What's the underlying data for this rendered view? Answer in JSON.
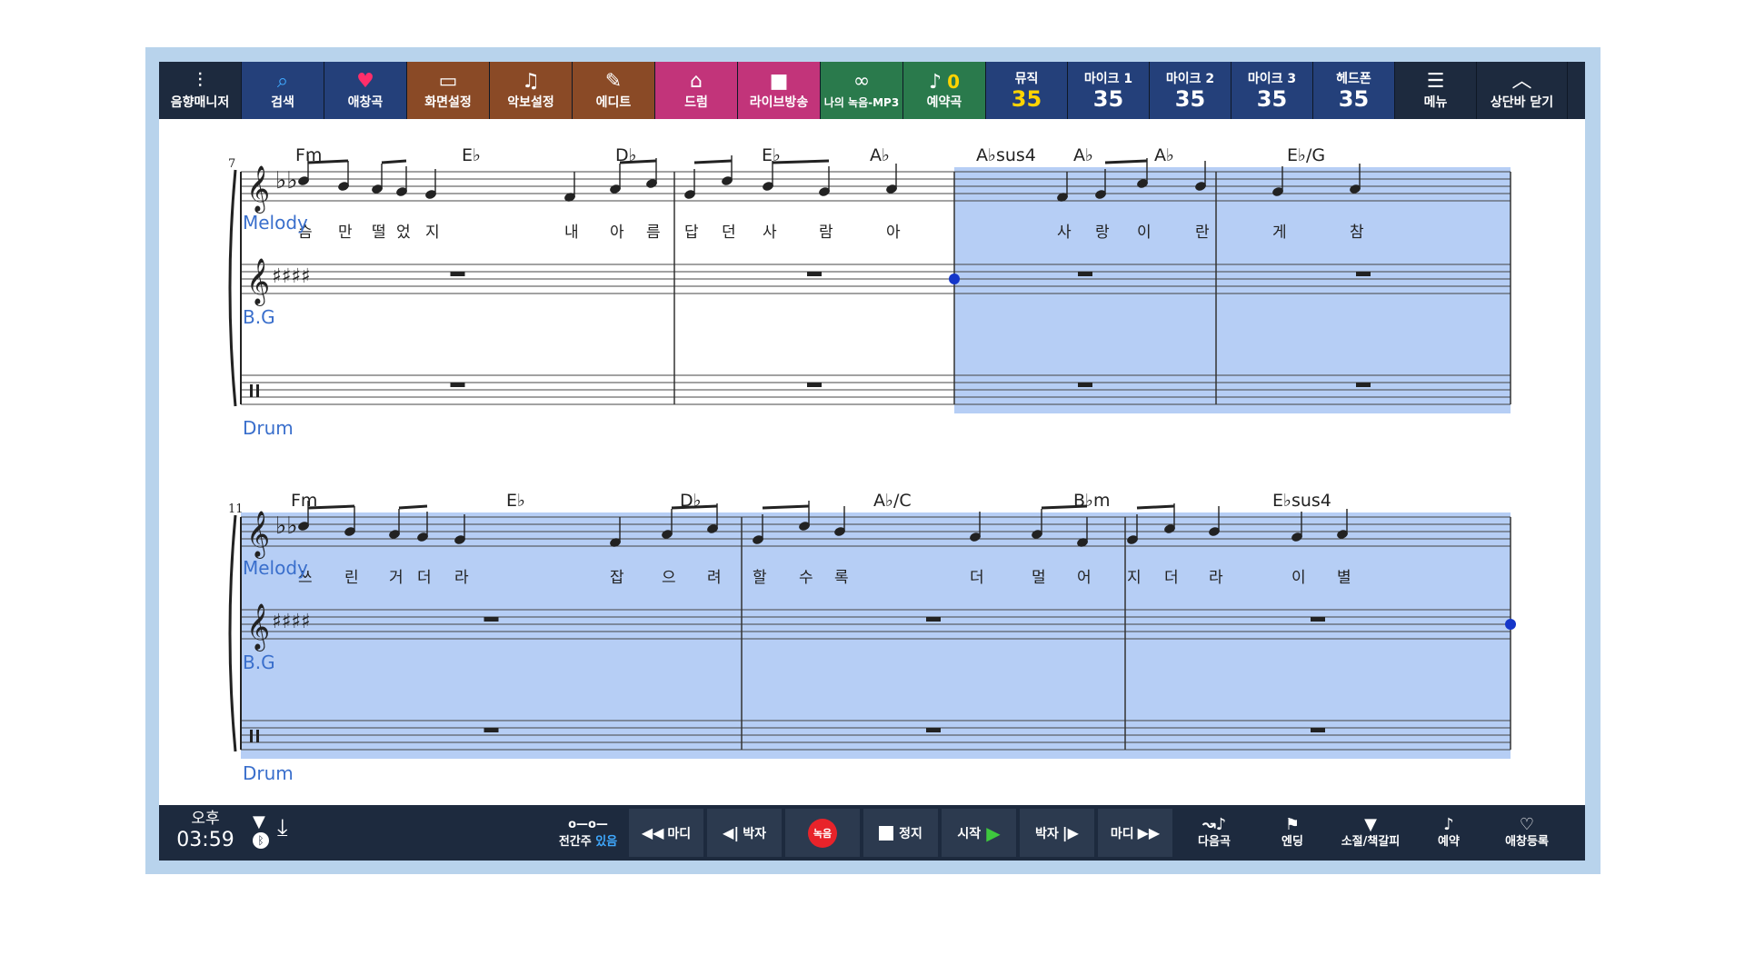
{
  "top_buttons": [
    {
      "label": "음향매니저",
      "icon": "sliders-icon",
      "glyph": "⫶",
      "bg": "#1d2a3e",
      "fg": "#ffffff"
    },
    {
      "label": "검색",
      "icon": "search-icon",
      "glyph": "⌕",
      "bg": "#24407a",
      "fg": "#3fa9ff"
    },
    {
      "label": "애창곡",
      "icon": "heart-icon",
      "glyph": "♥",
      "bg": "#24407a",
      "fg": "#ff2e6a"
    },
    {
      "label": "화면설정",
      "icon": "monitor-icon",
      "glyph": "▭",
      "bg": "#8a4a26",
      "fg": "#ffffff"
    },
    {
      "label": "악보설정",
      "icon": "music-note-icon",
      "glyph": "♫",
      "bg": "#8a4a26",
      "fg": "#ffffff"
    },
    {
      "label": "에디트",
      "icon": "edit-icon",
      "glyph": "✎",
      "bg": "#8a4a26",
      "fg": "#ffffff"
    },
    {
      "label": "드럼",
      "icon": "drum-icon",
      "glyph": "⌂",
      "bg": "#c2347a",
      "fg": "#ffffff"
    },
    {
      "label": "라이브방송",
      "icon": "video-camera-icon",
      "glyph": "■",
      "bg": "#c2347a",
      "fg": "#ffffff"
    },
    {
      "label": "나의 녹음-MP3",
      "icon": "tape-icon",
      "glyph": "∞",
      "bg": "#2a7a4c",
      "fg": "#ffffff"
    },
    {
      "label": "예약곡",
      "icon": "reserve-icon",
      "glyph": "♪",
      "bg": "#2a7a4c",
      "fg": "#ffffff"
    }
  ],
  "reserve_count": "0",
  "levels": [
    {
      "label": "뮤직",
      "value": "35",
      "value_color": "#ffd400"
    },
    {
      "label": "마이크 1",
      "value": "35",
      "value_color": "#ffffff"
    },
    {
      "label": "마이크 2",
      "value": "35",
      "value_color": "#ffffff"
    },
    {
      "label": "마이크 3",
      "value": "35",
      "value_color": "#ffffff"
    },
    {
      "label": "헤드폰",
      "value": "35",
      "value_color": "#ffffff"
    }
  ],
  "menu_label": "메뉴",
  "close_top_label": "상단바 닫기",
  "systems": [
    {
      "measure_number": "7",
      "chords": [
        "Fm",
        "E♭",
        "D♭",
        "E♭",
        "A♭",
        "A♭sus4",
        "A♭",
        "A♭",
        "E♭/G"
      ],
      "lyrics": [
        "슴",
        "만",
        "떨",
        "었",
        "지",
        "내",
        "아",
        "름",
        "답",
        "던",
        "사",
        "람",
        "아",
        "사",
        "랑",
        "이",
        "란",
        "게",
        "참"
      ]
    },
    {
      "measure_number": "11",
      "chords": [
        "Fm",
        "E♭",
        "D♭",
        "A♭/C",
        "B♭m",
        "E♭sus4"
      ],
      "lyrics": [
        "쓰",
        "린",
        "거",
        "더",
        "라",
        "잡",
        "으",
        "려",
        "할",
        "수",
        "록",
        "더",
        "멀",
        "어",
        "지",
        "더",
        "라",
        "이",
        "별"
      ]
    }
  ],
  "instruments": {
    "melody": "Melody",
    "bg": "B.G",
    "drum": "Drum"
  },
  "clock": {
    "ampm": "오후",
    "time": "03:59"
  },
  "bottom": {
    "intro_label": "전간주",
    "intro_state": "있음",
    "prev_measure": "마디",
    "prev_beat": "박자",
    "record": "녹음",
    "stop": "정지",
    "start": "시작",
    "next_beat": "박자",
    "next_measure": "마디",
    "next_song": "다음곡",
    "ending": "엔딩",
    "bookmark": "소절/책갈피",
    "reserve": "예약",
    "fav_add": "애창등록"
  }
}
